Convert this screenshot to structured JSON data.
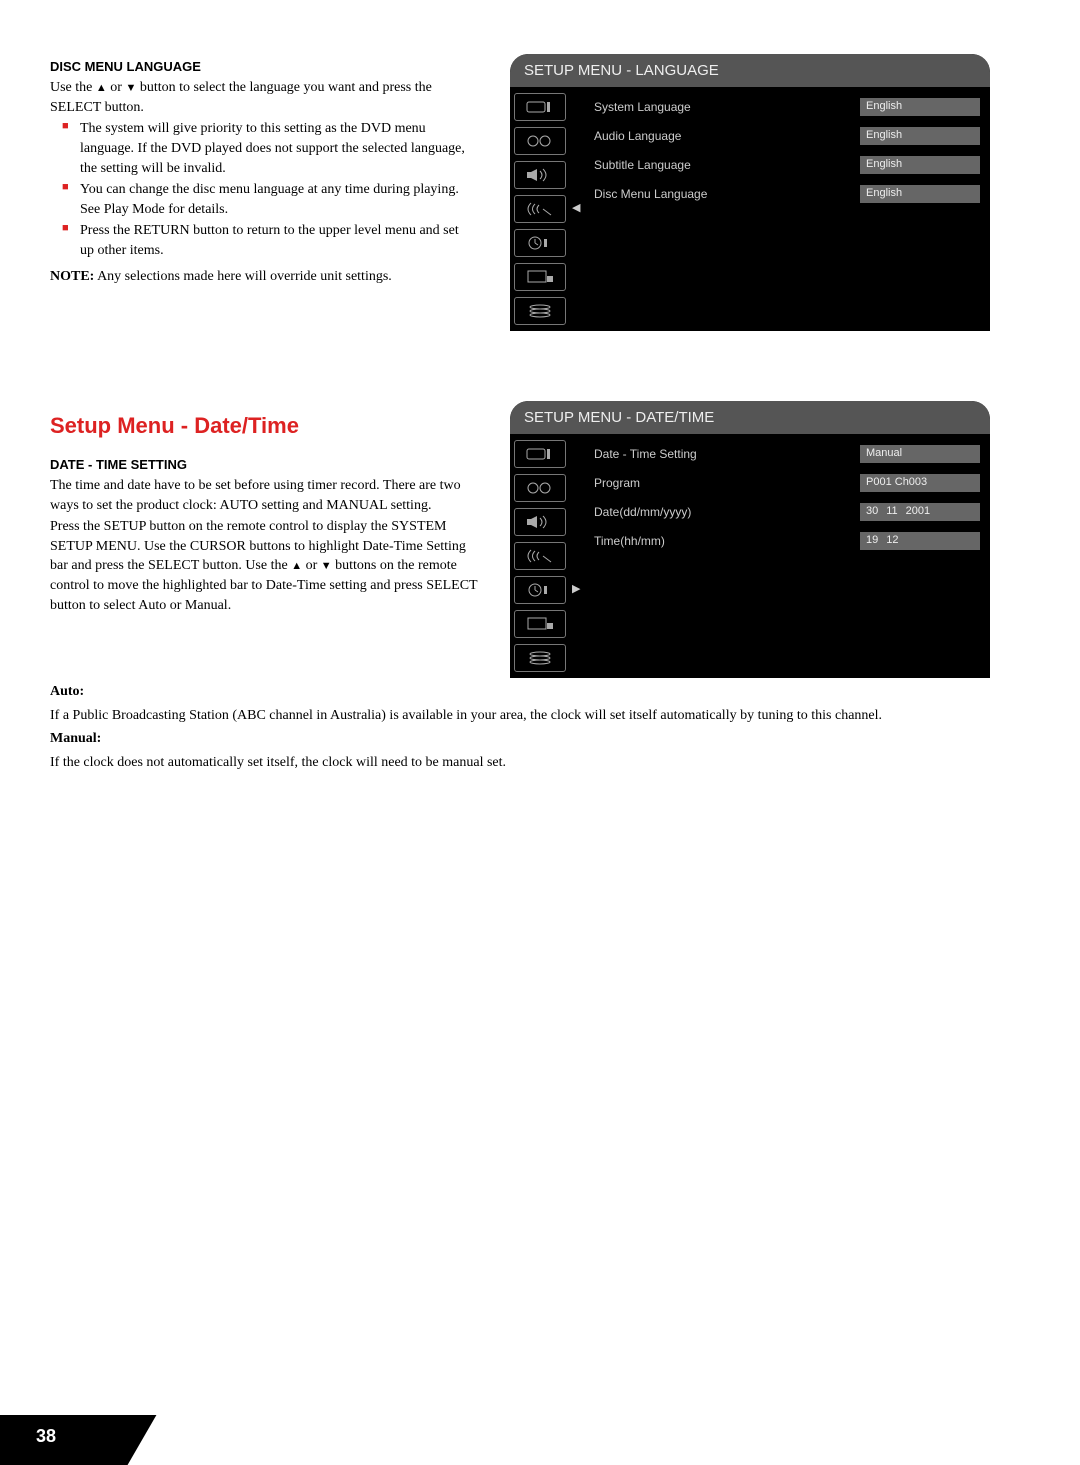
{
  "section1": {
    "subhead": "Disc Menu Language",
    "intro_a": "Use the ",
    "intro_up": "▲",
    "intro_b": " or ",
    "intro_dn": "▼",
    "intro_c": " button to select the language you want and press the SELECT button.",
    "bul1": "The system will give priority to this setting as the DVD menu language. If the DVD played does not support the selected language, the setting will be invalid.",
    "bul2": "You can change the disc menu language at any time during playing. See Play Mode for details.",
    "bul3": "Press the RETURN button to return to the upper level menu and set up other items.",
    "note_label": "NOTE:",
    "note_text": " Any selections made here will override unit settings."
  },
  "osd1": {
    "title": "SETUP MENU - LANGUAGE",
    "arrow_glyph": "◀",
    "rows": [
      {
        "label": "System Language",
        "value": "English"
      },
      {
        "label": "Audio Language",
        "value": "English"
      },
      {
        "label": "Subtitle Language",
        "value": "English"
      },
      {
        "label": "Disc Menu Language",
        "value": "English"
      }
    ]
  },
  "heading2": "Setup Menu - Date/Time",
  "section2": {
    "subhead": "Date - Time Setting",
    "para1": "The time and date have to be set before using timer record. There are two ways to set the product clock: AUTO setting and MANUAL setting.",
    "para2a": "Press the SETUP button on the remote control to display the SYSTEM SETUP MENU. Use the CURSOR buttons to highlight Date-Time Setting bar and press the SELECT button. Use the ",
    "para2_up": "▲",
    "para2b": " or ",
    "para2_dn": "▼",
    "para2c": " buttons on the remote control to move the highlighted bar to Date-Time setting and press SELECT button to select Auto or Manual.",
    "auto_label": "Auto:",
    "auto_text": "If a Public Broadcasting Station (ABC channel in Australia) is available in your area, the clock will set itself automatically by tuning to this channel.",
    "manual_label": "Manual:",
    "manual_text": "If the clock does not automatically set itself, the clock will need to be manual set."
  },
  "osd2": {
    "title": "SETUP MENU - DATE/TIME",
    "arrow_glyph": "▶",
    "rows": [
      {
        "label": "Date - Time Setting",
        "value": "Manual",
        "type": "single"
      },
      {
        "label": "Program",
        "value": "P001 Ch003",
        "type": "single"
      },
      {
        "label": "Date(dd/mm/yyyy)",
        "v1": "30",
        "v2": "11",
        "v3": "2001",
        "type": "triple"
      },
      {
        "label": "Time(hh/mm)",
        "v1": "19",
        "v2": "12",
        "type": "double"
      }
    ]
  },
  "page_number": "38"
}
